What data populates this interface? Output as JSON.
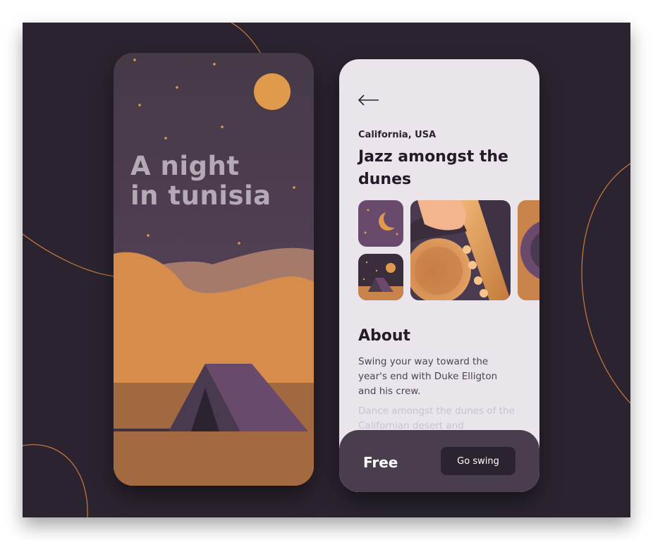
{
  "poster": {
    "title": "A night\nin tunisia"
  },
  "detail": {
    "location": "California, USA",
    "title": "Jazz amongst the dunes",
    "about": {
      "heading": "About",
      "paragraph1": "Swing your way toward the year's end with Duke Elligton and his crew.",
      "paragraph2": "Dance amongst the dunes of the Californian desert and"
    },
    "footer": {
      "price": "Free",
      "cta_label": "Go swing"
    }
  },
  "icons": {
    "back": "arrow-left-icon"
  },
  "colors": {
    "background": "#2b2430",
    "accent": "#e09a4c",
    "sky_purple": "#4f3e55",
    "dune_orange": "#d98f4a",
    "tent_purple": "#6a4a6c",
    "panel_light": "#e9e5ea"
  }
}
